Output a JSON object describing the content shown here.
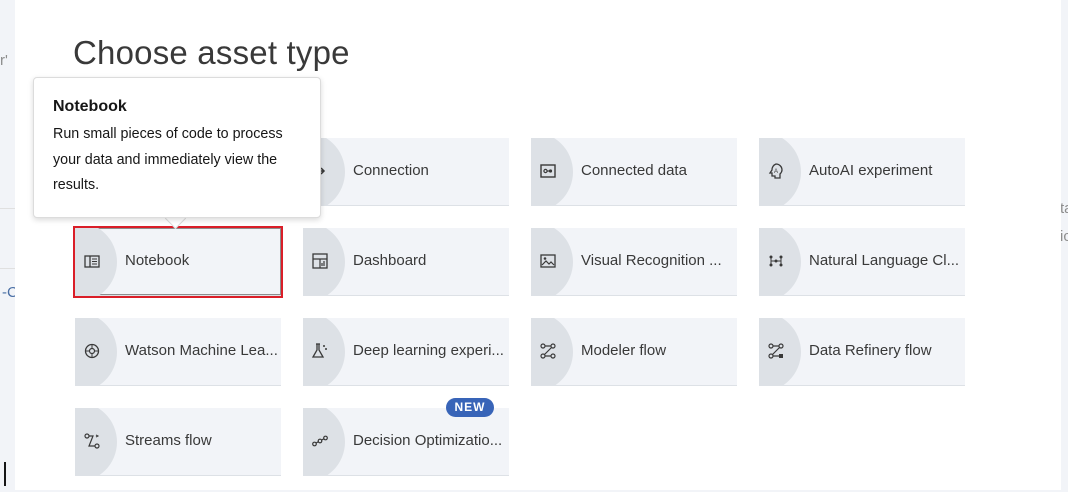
{
  "background": {
    "frag_left_top": "r'",
    "frag_left_mid": "-C",
    "frag_right_1": "ta",
    "frag_right_2": "ic"
  },
  "modal": {
    "title": "Choose asset type",
    "close_glyph": "×"
  },
  "tiles": [
    {
      "label": "Connection",
      "icon": "connection-icon"
    },
    {
      "label": "Connected data",
      "icon": "connected-data-icon"
    },
    {
      "label": "AutoAI experiment",
      "icon": "autoai-icon"
    },
    {
      "label": "Notebook",
      "icon": "notebook-icon",
      "selected": true
    },
    {
      "label": "Dashboard",
      "icon": "dashboard-icon"
    },
    {
      "label": "Visual Recognition ...",
      "icon": "visual-recognition-icon"
    },
    {
      "label": "Natural Language Cl...",
      "icon": "natural-language-icon"
    },
    {
      "label": "Watson Machine Lea...",
      "icon": "watson-ml-icon"
    },
    {
      "label": "Deep learning experi...",
      "icon": "deep-learning-icon"
    },
    {
      "label": "Modeler flow",
      "icon": "modeler-flow-icon"
    },
    {
      "label": "Data Refinery flow",
      "icon": "data-refinery-icon"
    },
    {
      "label": "Streams flow",
      "icon": "streams-flow-icon"
    },
    {
      "label": "Decision Optimizatio...",
      "icon": "decision-optimization-icon"
    }
  ],
  "badge": {
    "label": "NEW"
  },
  "tooltip": {
    "title": "Notebook",
    "body": "Run small pieces of code to process your data and immediately view the results."
  },
  "colors": {
    "accent_selected": "#da1e28",
    "badge": "#3864b8",
    "tile_bg": "#f2f4f8"
  }
}
